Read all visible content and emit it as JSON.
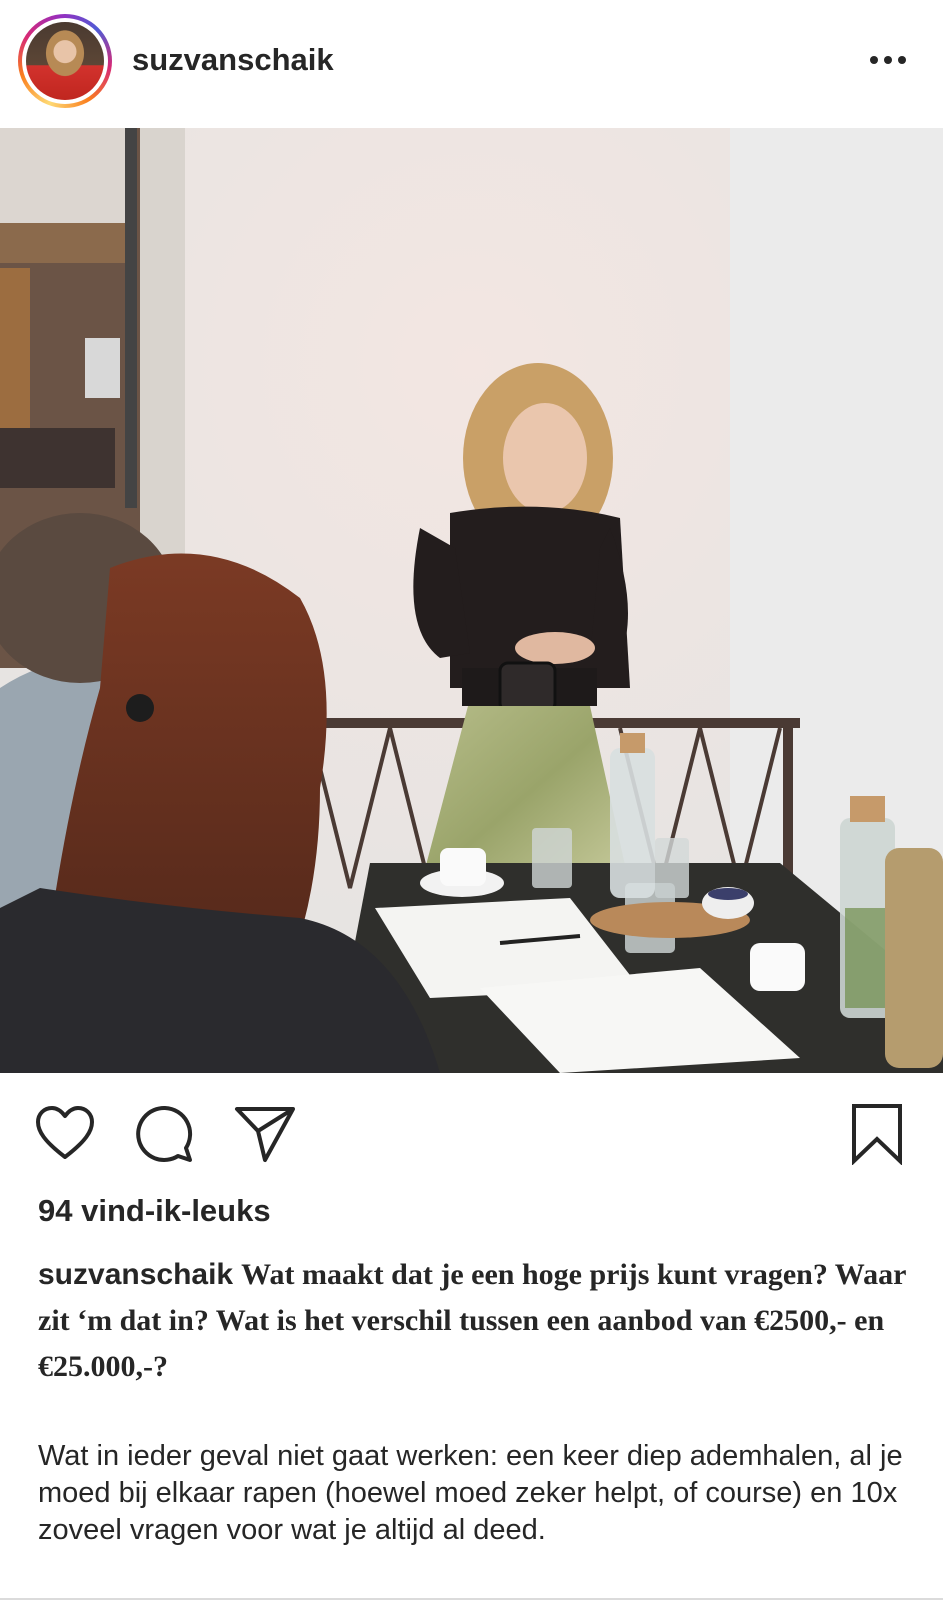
{
  "post": {
    "username": "suzvanschaik",
    "likes": "94 vind-ik-leuks",
    "caption_user": "suzvanschaik",
    "caption_text": "Wat maakt dat je een hoge prijs kunt vragen? Waar zit ‘m dat in? Wat is het verschil tussen een aanbod van €2500,- en €25.000,-?",
    "body_text": "Wat in ieder geval niet gaat werken: een keer diep ademhalen, al je moed bij elkaar rapen (hoewel moed zeker helpt, of course) en 10x zoveel vragen voor wat je altijd al deed."
  },
  "icons": {
    "more": "more-options-icon",
    "like": "heart-icon",
    "comment": "comment-icon",
    "share": "send-icon",
    "save": "bookmark-icon"
  },
  "colors": {
    "text": "#262626",
    "divider": "#dbdbdb",
    "story_ring": "#d62976"
  }
}
